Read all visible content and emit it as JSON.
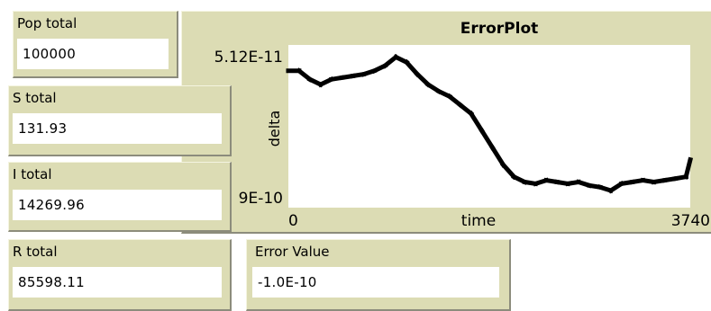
{
  "monitors": [
    {
      "label": "Pop total",
      "value": "100000"
    },
    {
      "label": "S total",
      "value": "131.93"
    },
    {
      "label": "I total",
      "value": "14269.96"
    },
    {
      "label": "R total",
      "value": "85598.11"
    },
    {
      "label": "Error Value",
      "value": "-1.0E-10"
    }
  ],
  "plot": {
    "title": "ErrorPlot",
    "xlabel": "time",
    "ylabel": "delta",
    "x_min_label": "0",
    "x_max_label": "3740",
    "y_max_label": "5.12E-11",
    "y_min_label": "9E-10"
  },
  "colors": {
    "monitor_bg": "#dcdcb4",
    "value_bg": "#ffffff",
    "plot_bg": "#ffffff",
    "pen": "#000000"
  },
  "chart_data": {
    "type": "line",
    "title": "ErrorPlot",
    "xlabel": "time",
    "ylabel": "delta",
    "xlim": [
      0,
      3740
    ],
    "ylim": [
      -9e-10,
      5.12e-11
    ],
    "grid": false,
    "series": [
      {
        "x": [
          0,
          100,
          200,
          300,
          400,
          500,
          600,
          700,
          800,
          900,
          1000,
          1100,
          1200,
          1300,
          1400,
          1500,
          1600,
          1700,
          1800,
          1900,
          2000,
          2100,
          2200,
          2300,
          2400,
          2500,
          2600,
          2700,
          2800,
          2900,
          3000,
          3100,
          3200,
          3300,
          3400,
          3500,
          3600,
          3700,
          3740
        ],
        "y": [
          -1e-10,
          -1e-10,
          -1.5e-10,
          -1.8e-10,
          -1.5e-10,
          -1.4e-10,
          -1.3e-10,
          -1.2e-10,
          -1e-10,
          -7e-11,
          -2e-11,
          -5e-11,
          -1.2e-10,
          -1.8e-10,
          -2.2e-10,
          -2.5e-10,
          -3e-10,
          -3.5e-10,
          -4.5e-10,
          -5.5e-10,
          -6.5e-10,
          -7.2e-10,
          -7.5e-10,
          -7.6e-10,
          -7.4e-10,
          -7.5e-10,
          -7.6e-10,
          -7.5e-10,
          -7.7e-10,
          -7.8e-10,
          -8e-10,
          -7.6e-10,
          -7.5e-10,
          -7.4e-10,
          -7.5e-10,
          -7.4e-10,
          -7.3e-10,
          -7.2e-10,
          -6.2e-10
        ]
      }
    ]
  }
}
